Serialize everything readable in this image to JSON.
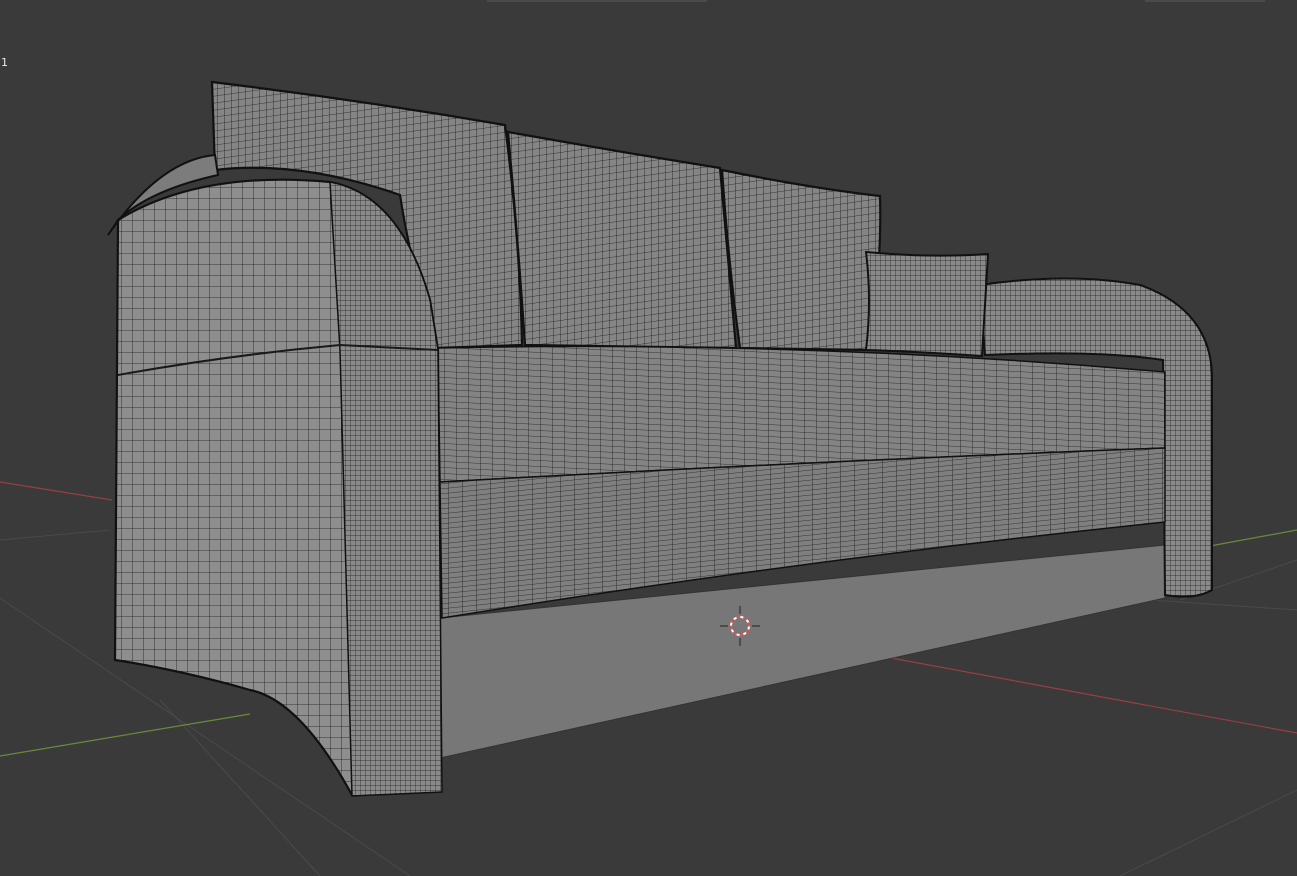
{
  "viewport": {
    "overlay_label": "1",
    "background": "#3a3a3a",
    "grid_color": "#4c4c4c",
    "x_axis_color": "#9a3e44",
    "y_axis_color": "#6a8a3a"
  },
  "mesh": {
    "fill": "#8a8a8a",
    "fill_dark": "#747474",
    "fill_light": "#9a9a9a",
    "wire": "#1c1c1c",
    "base_fill": "#767676"
  },
  "cursor": {
    "ring_primary": "#e05050",
    "ring_secondary": "#ffffff",
    "icon": "3d-cursor-icon"
  }
}
